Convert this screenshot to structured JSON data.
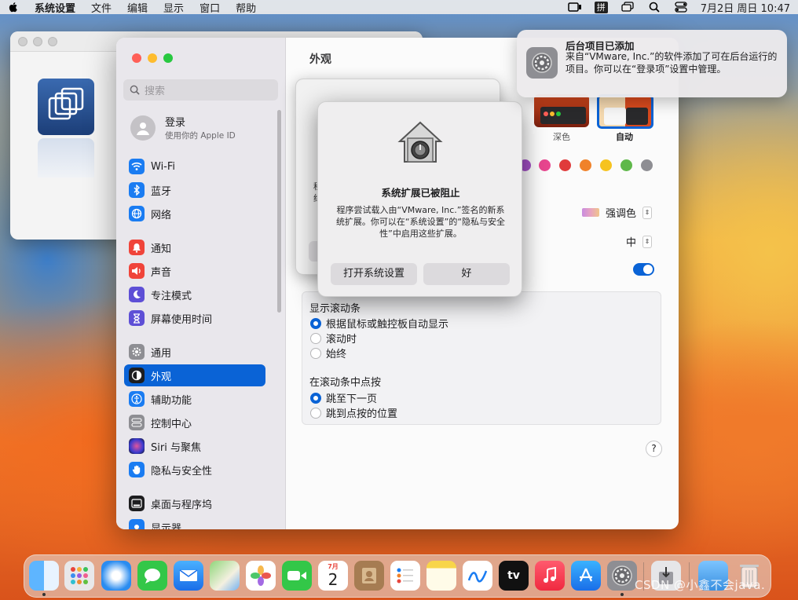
{
  "menubar": {
    "app_name": "系统设置",
    "items": [
      "文件",
      "编辑",
      "显示",
      "窗口",
      "帮助"
    ],
    "ime": "拼",
    "clock": "7月2日 周日  10:47"
  },
  "sidebar": {
    "search_placeholder": "搜索",
    "account_title": "登录",
    "account_subtitle": "使用你的 Apple ID",
    "items": [
      {
        "label": "Wi-Fi"
      },
      {
        "label": "蓝牙"
      },
      {
        "label": "网络"
      },
      {
        "label": "通知"
      },
      {
        "label": "声音"
      },
      {
        "label": "专注模式"
      },
      {
        "label": "屏幕使用时间"
      },
      {
        "label": "通用"
      },
      {
        "label": "外观"
      },
      {
        "label": "辅助功能"
      },
      {
        "label": "控制中心"
      },
      {
        "label": "Siri 与聚焦"
      },
      {
        "label": "隐私与安全性"
      },
      {
        "label": "桌面与程序坞"
      },
      {
        "label": "显示器"
      }
    ]
  },
  "content": {
    "title": "外观",
    "theme_dark": "深色",
    "theme_auto": "自动",
    "highlight_label": "强调色",
    "sidebar_size_value": "中",
    "colors": {
      "accent": "#0a63d6",
      "swatches": [
        "#a04ec2",
        "#e8468f",
        "#e03b3b",
        "#f0822a",
        "#f6c31f",
        "#5fb84a",
        "#8e8e93"
      ]
    },
    "scrollbars": {
      "title": "显示滚动条",
      "options": [
        "根据鼠标或触控板自动显示",
        "滚动时",
        "始终"
      ],
      "click_title": "在滚动条中点按",
      "click_options": [
        "跳至下一页",
        "跳到点按的位置"
      ]
    },
    "help": "?"
  },
  "back_sheet_fragments": [
    "程",
    "约"
  ],
  "alert": {
    "title": "系统扩展已被阻止",
    "message": "程序尝试载入由“VMware, Inc.”签名的新系统扩展。你可以在“系统设置”的“隐私与安全性”中启用这些扩展。",
    "button_open": "打开系统设置",
    "button_ok": "好"
  },
  "notification": {
    "title": "后台项目已添加",
    "body": "来自“VMware, Inc.”的软件添加了可在后台运行的项目。你可以在“登录项”设置中管理。"
  },
  "dock": {
    "calendar_month": "7月",
    "calendar_day": "2",
    "tv_label": "tv"
  },
  "watermark": "CSDN @小鑫不会java."
}
